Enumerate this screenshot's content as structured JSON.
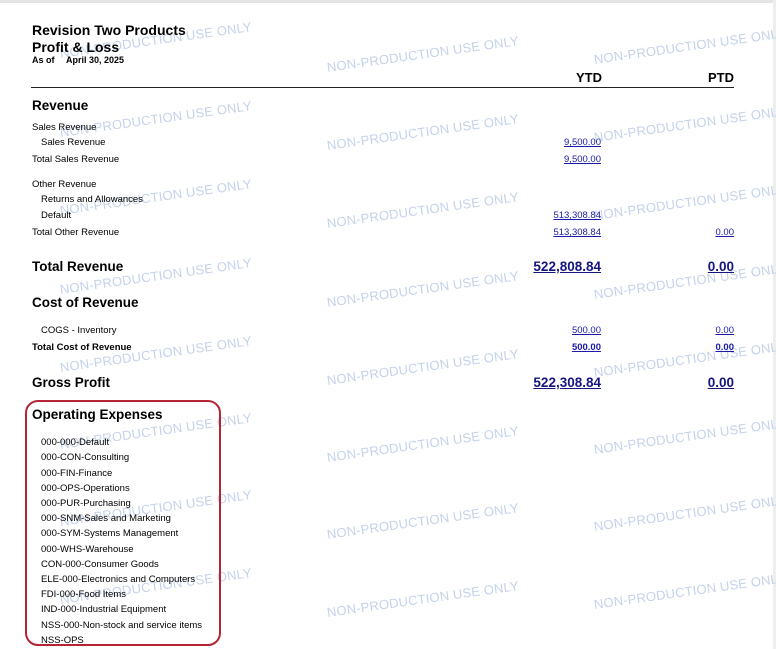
{
  "report": {
    "company": "Revision Two Products",
    "title": "Profit & Loss",
    "as_of_label": "As of",
    "as_of_date": "April 30, 2025",
    "columns": {
      "ytd": "YTD",
      "ptd": "PTD"
    }
  },
  "watermark": "NON-PRODUCTION USE ONLY",
  "revenue": {
    "heading": "Revenue",
    "sales_group": "Sales Revenue",
    "sales_item": "Sales Revenue",
    "sales_item_ytd": "9,500.00",
    "sales_total_label": "Total Sales Revenue",
    "sales_total_ytd": "9,500.00",
    "other_group": "Other Revenue",
    "returns_item": "Returns and Allowances",
    "default_item": "Default",
    "default_ytd": "513,308.84",
    "other_total_label": "Total Other Revenue",
    "other_total_ytd": "513,308.84",
    "other_total_ptd": "0.00",
    "total_label": "Total Revenue",
    "total_ytd": "522,808.84",
    "total_ptd": "0.00"
  },
  "cost": {
    "heading": "Cost of Revenue",
    "cogs_item": "COGS - Inventory",
    "cogs_ytd": "500.00",
    "cogs_ptd": "0.00",
    "total_label": "Total Cost of Revenue",
    "total_ytd": "500.00",
    "total_ptd": "0.00"
  },
  "gross": {
    "label": "Gross Profit",
    "ytd": "522,308.84",
    "ptd": "0.00"
  },
  "opex": {
    "heading": "Operating Expenses",
    "items": [
      "000-000-Default",
      "000-CON-Consulting",
      "000-FIN-Finance",
      "000-OPS-Operations",
      "000-PUR-Purchasing",
      "000-SNM-Sales and Marketing",
      "000-SYM-Systems Management",
      "000-WHS-Warehouse",
      "CON-000-Consumer Goods",
      "ELE-000-Electronics and Computers",
      "FDI-000-Food Items",
      "IND-000-Industrial Equipment",
      "NSS-000-Non-stock and service items",
      "NSS-OPS"
    ]
  }
}
